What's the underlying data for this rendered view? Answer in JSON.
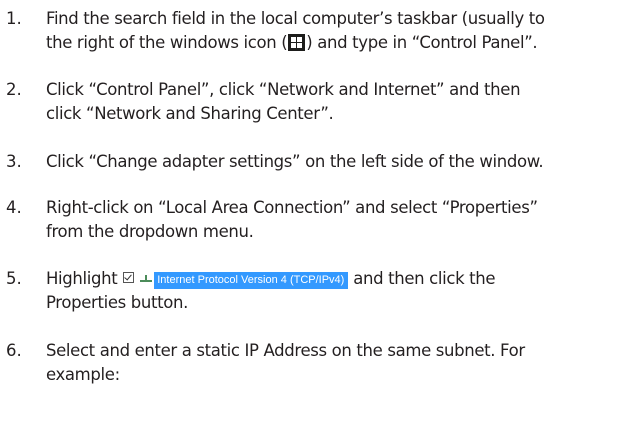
{
  "steps": [
    {
      "number": "1.",
      "line1_before": "Find the search field in the local computer’s taskbar (usually to",
      "line2_before": "the right of the windows icon (",
      "icon": "windows-logo-icon",
      "line2_after": ") and type in “Control Panel”."
    },
    {
      "number": "2.",
      "line1": "Click “Control Panel”, click “Network and Internet” and then",
      "line2": "click “Network and Sharing Center”."
    },
    {
      "number": "3.",
      "line1": "Click “Change adapter settings” on the left side of the window."
    },
    {
      "number": "4.",
      "line1": "Right-click on “Local Area Connection” and select “Properties”",
      "line2": "from the dropdown menu."
    },
    {
      "number": "5.",
      "line1_before": "Highlight",
      "checkbox_icon": "checked-checkbox-icon",
      "network_icon": "network-protocol-icon",
      "highlight_label": "Internet Protocol Version 4 (TCP/IPv4)",
      "line1_after": "and then click the",
      "line2": "Properties button."
    },
    {
      "number": "6.",
      "line1": "Select and enter a static IP Address on the same subnet. For",
      "line2": "example:"
    }
  ],
  "colors": {
    "text": "#231f20",
    "highlight_background": "#3399ff",
    "highlight_text": "#ffffff"
  }
}
